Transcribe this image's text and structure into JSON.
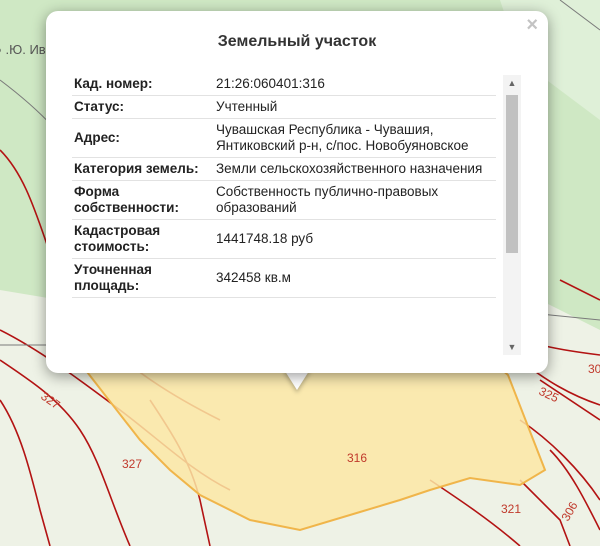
{
  "map": {
    "street_label": ".Ю. Ива",
    "parcels": [
      "327",
      "327",
      "316",
      "325",
      "321",
      "306",
      "30"
    ]
  },
  "popup": {
    "title": "Земельный участок",
    "close_symbol": "×",
    "rows": [
      {
        "label": "Кад. номер:",
        "value": "21:26:060401:316"
      },
      {
        "label": "Статус:",
        "value": "Учтенный"
      },
      {
        "label": "Адрес:",
        "value": "Чувашская Республика - Чувашия, Янтиковский р-н, с/пос. Новобуяновское"
      },
      {
        "label": "Категория земель:",
        "value": "Земли сельскохозяйственного назначения"
      },
      {
        "label": "Форма собственности:",
        "value": "Собственность публично-правовых образований"
      },
      {
        "label": "Кадастровая стоимость:",
        "value": "1441748.18 руб"
      },
      {
        "label": "Уточненная площадь:",
        "value": "342458 кв.м"
      }
    ]
  },
  "colors": {
    "map_bg": "#e8f0e0",
    "green_area": "#cfe8c4",
    "selected_parcel_fill": "#fce7a4",
    "selected_parcel_stroke": "#f0b54a",
    "parcel_border": "#b31313"
  }
}
